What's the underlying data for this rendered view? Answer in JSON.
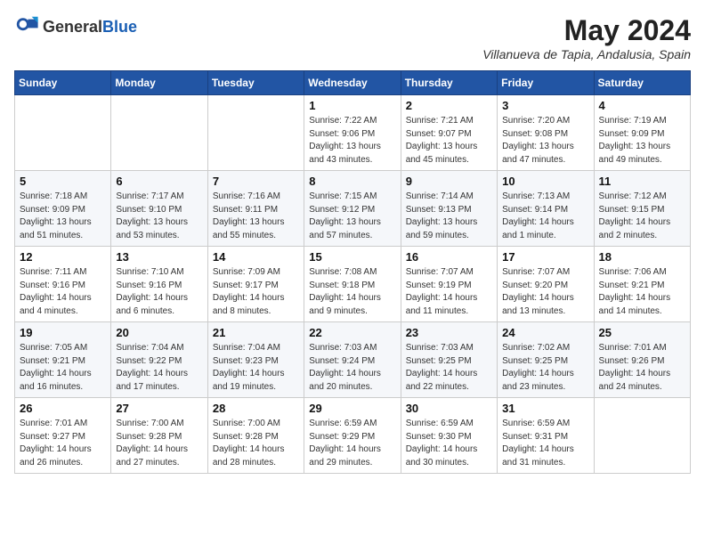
{
  "header": {
    "logo_general": "General",
    "logo_blue": "Blue",
    "month_year": "May 2024",
    "location": "Villanueva de Tapia, Andalusia, Spain"
  },
  "days_of_week": [
    "Sunday",
    "Monday",
    "Tuesday",
    "Wednesday",
    "Thursday",
    "Friday",
    "Saturday"
  ],
  "weeks": [
    [
      {
        "day": "",
        "info": ""
      },
      {
        "day": "",
        "info": ""
      },
      {
        "day": "",
        "info": ""
      },
      {
        "day": "1",
        "info": "Sunrise: 7:22 AM\nSunset: 9:06 PM\nDaylight: 13 hours\nand 43 minutes."
      },
      {
        "day": "2",
        "info": "Sunrise: 7:21 AM\nSunset: 9:07 PM\nDaylight: 13 hours\nand 45 minutes."
      },
      {
        "day": "3",
        "info": "Sunrise: 7:20 AM\nSunset: 9:08 PM\nDaylight: 13 hours\nand 47 minutes."
      },
      {
        "day": "4",
        "info": "Sunrise: 7:19 AM\nSunset: 9:09 PM\nDaylight: 13 hours\nand 49 minutes."
      }
    ],
    [
      {
        "day": "5",
        "info": "Sunrise: 7:18 AM\nSunset: 9:09 PM\nDaylight: 13 hours\nand 51 minutes."
      },
      {
        "day": "6",
        "info": "Sunrise: 7:17 AM\nSunset: 9:10 PM\nDaylight: 13 hours\nand 53 minutes."
      },
      {
        "day": "7",
        "info": "Sunrise: 7:16 AM\nSunset: 9:11 PM\nDaylight: 13 hours\nand 55 minutes."
      },
      {
        "day": "8",
        "info": "Sunrise: 7:15 AM\nSunset: 9:12 PM\nDaylight: 13 hours\nand 57 minutes."
      },
      {
        "day": "9",
        "info": "Sunrise: 7:14 AM\nSunset: 9:13 PM\nDaylight: 13 hours\nand 59 minutes."
      },
      {
        "day": "10",
        "info": "Sunrise: 7:13 AM\nSunset: 9:14 PM\nDaylight: 14 hours\nand 1 minute."
      },
      {
        "day": "11",
        "info": "Sunrise: 7:12 AM\nSunset: 9:15 PM\nDaylight: 14 hours\nand 2 minutes."
      }
    ],
    [
      {
        "day": "12",
        "info": "Sunrise: 7:11 AM\nSunset: 9:16 PM\nDaylight: 14 hours\nand 4 minutes."
      },
      {
        "day": "13",
        "info": "Sunrise: 7:10 AM\nSunset: 9:16 PM\nDaylight: 14 hours\nand 6 minutes."
      },
      {
        "day": "14",
        "info": "Sunrise: 7:09 AM\nSunset: 9:17 PM\nDaylight: 14 hours\nand 8 minutes."
      },
      {
        "day": "15",
        "info": "Sunrise: 7:08 AM\nSunset: 9:18 PM\nDaylight: 14 hours\nand 9 minutes."
      },
      {
        "day": "16",
        "info": "Sunrise: 7:07 AM\nSunset: 9:19 PM\nDaylight: 14 hours\nand 11 minutes."
      },
      {
        "day": "17",
        "info": "Sunrise: 7:07 AM\nSunset: 9:20 PM\nDaylight: 14 hours\nand 13 minutes."
      },
      {
        "day": "18",
        "info": "Sunrise: 7:06 AM\nSunset: 9:21 PM\nDaylight: 14 hours\nand 14 minutes."
      }
    ],
    [
      {
        "day": "19",
        "info": "Sunrise: 7:05 AM\nSunset: 9:21 PM\nDaylight: 14 hours\nand 16 minutes."
      },
      {
        "day": "20",
        "info": "Sunrise: 7:04 AM\nSunset: 9:22 PM\nDaylight: 14 hours\nand 17 minutes."
      },
      {
        "day": "21",
        "info": "Sunrise: 7:04 AM\nSunset: 9:23 PM\nDaylight: 14 hours\nand 19 minutes."
      },
      {
        "day": "22",
        "info": "Sunrise: 7:03 AM\nSunset: 9:24 PM\nDaylight: 14 hours\nand 20 minutes."
      },
      {
        "day": "23",
        "info": "Sunrise: 7:03 AM\nSunset: 9:25 PM\nDaylight: 14 hours\nand 22 minutes."
      },
      {
        "day": "24",
        "info": "Sunrise: 7:02 AM\nSunset: 9:25 PM\nDaylight: 14 hours\nand 23 minutes."
      },
      {
        "day": "25",
        "info": "Sunrise: 7:01 AM\nSunset: 9:26 PM\nDaylight: 14 hours\nand 24 minutes."
      }
    ],
    [
      {
        "day": "26",
        "info": "Sunrise: 7:01 AM\nSunset: 9:27 PM\nDaylight: 14 hours\nand 26 minutes."
      },
      {
        "day": "27",
        "info": "Sunrise: 7:00 AM\nSunset: 9:28 PM\nDaylight: 14 hours\nand 27 minutes."
      },
      {
        "day": "28",
        "info": "Sunrise: 7:00 AM\nSunset: 9:28 PM\nDaylight: 14 hours\nand 28 minutes."
      },
      {
        "day": "29",
        "info": "Sunrise: 6:59 AM\nSunset: 9:29 PM\nDaylight: 14 hours\nand 29 minutes."
      },
      {
        "day": "30",
        "info": "Sunrise: 6:59 AM\nSunset: 9:30 PM\nDaylight: 14 hours\nand 30 minutes."
      },
      {
        "day": "31",
        "info": "Sunrise: 6:59 AM\nSunset: 9:31 PM\nDaylight: 14 hours\nand 31 minutes."
      },
      {
        "day": "",
        "info": ""
      }
    ]
  ]
}
